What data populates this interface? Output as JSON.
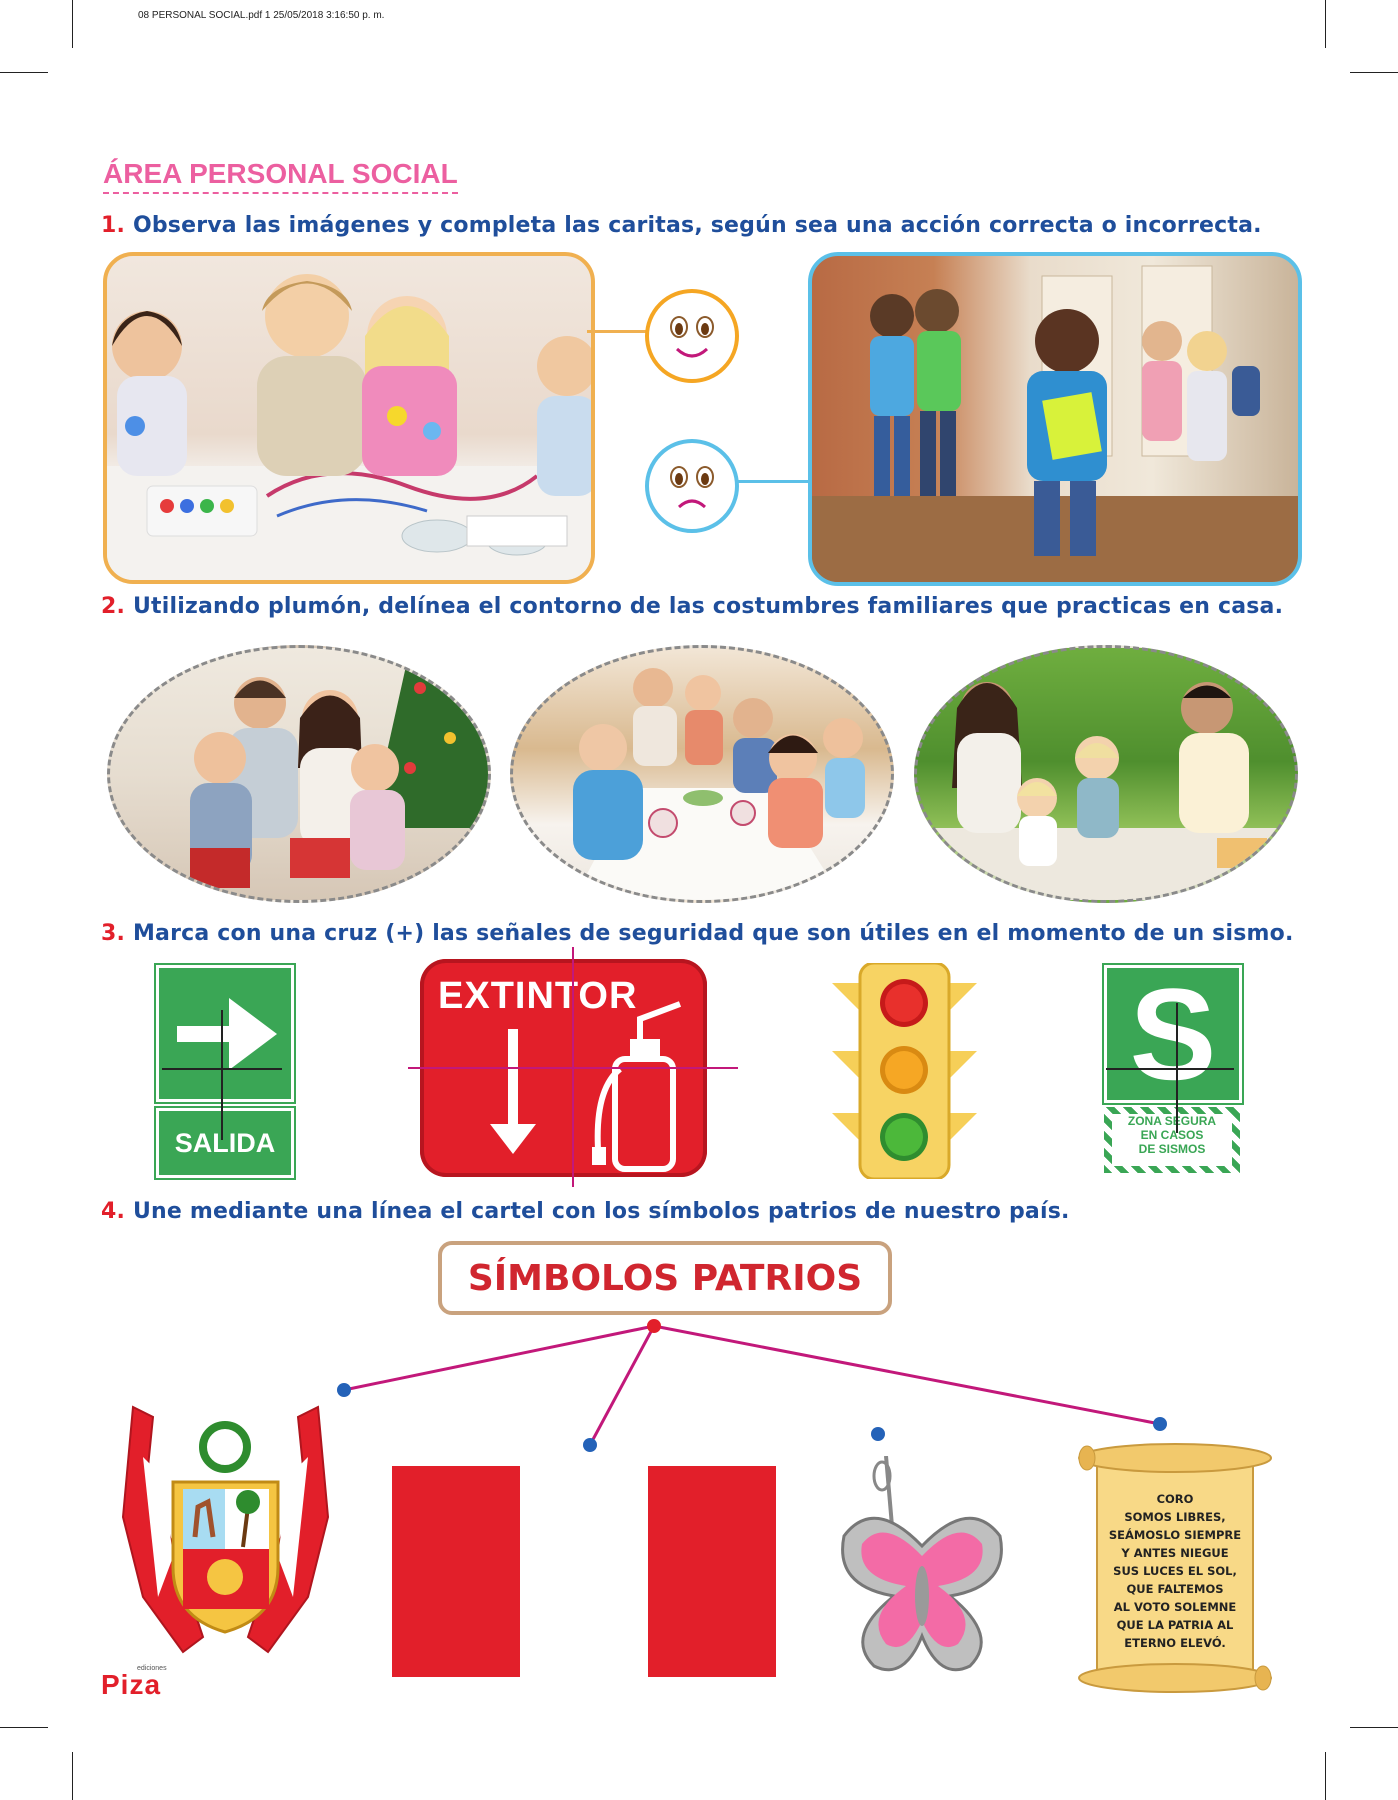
{
  "file_header": "08 PERSONAL SOCIAL.pdf   1   25/05/2018   3:16:50 p. m.",
  "area_title": "ÁREA PERSONAL SOCIAL",
  "questions": [
    {
      "num": "1.",
      "text": "Observa las imágenes y completa las caritas, según sea una acción correcta o incorrecta."
    },
    {
      "num": "2.",
      "text": "Utilizando plumón, delínea el contorno de las costumbres familiares que practicas en casa."
    },
    {
      "num": "3.",
      "text": "Marca con una cruz (+) las señales de seguridad que son útiles en el momento de un sismo."
    },
    {
      "num": "4.",
      "text": "Une mediante una línea el cartel con los símbolos patrios de nuestro país."
    }
  ],
  "signs": {
    "salida": "SALIDA",
    "extintor": "EXTINTOR",
    "zona_segura": [
      "ZONA SEGURA",
      "EN CASOS",
      "DE SISMOS"
    ],
    "s_letter": "S"
  },
  "simbolos_title": "SÍMBOLOS PATRIOS",
  "anthem_lines": [
    "CORO",
    "SOMOS LIBRES,",
    "SEÁMOSLO SIEMPRE",
    "Y ANTES NIEGUE",
    "SUS LUCES EL SOL,",
    "QUE FALTEMOS",
    "AL VOTO SOLEMNE",
    "QUE LA PATRIA AL",
    "ETERNO ELEVÓ."
  ],
  "logo": {
    "small": "ediciones",
    "brand": "Piza"
  },
  "colors": {
    "title_pink": "#ec5fa0",
    "question_blue": "#1f4e9b",
    "number_red": "#e21f2a",
    "happy_orange": "#f5a623",
    "sad_blue": "#5bc0e8",
    "sign_green": "#3aa655",
    "sign_red": "#e21f2a"
  }
}
